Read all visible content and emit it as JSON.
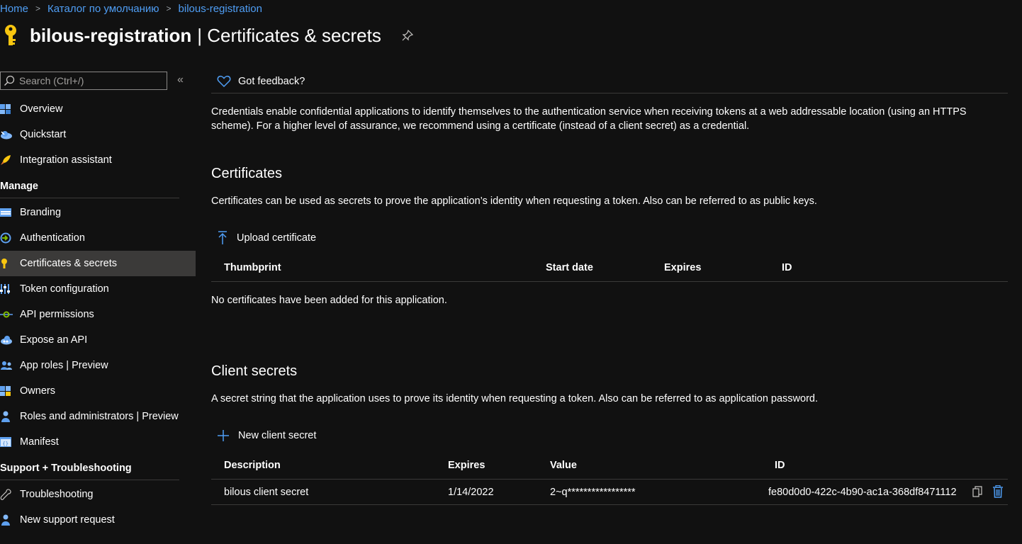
{
  "breadcrumb": [
    "Home",
    "Каталог по умолчанию",
    "bilous-registration"
  ],
  "header": {
    "app_name": "bilous-registration",
    "page_name": "| Certificates & secrets"
  },
  "sidebar": {
    "search_placeholder": "Search (Ctrl+/)",
    "collapse": "«",
    "top_items": [
      {
        "label": "Overview",
        "icon": "overview-icon"
      },
      {
        "label": "Quickstart",
        "icon": "quickstart-icon"
      },
      {
        "label": "Integration assistant",
        "icon": "rocket-icon"
      }
    ],
    "manage_title": "Manage",
    "manage_items": [
      {
        "label": "Branding",
        "icon": "branding-icon"
      },
      {
        "label": "Authentication",
        "icon": "authentication-icon"
      },
      {
        "label": "Certificates & secrets",
        "icon": "key-icon",
        "active": true
      },
      {
        "label": "Token configuration",
        "icon": "token-icon"
      },
      {
        "label": "API permissions",
        "icon": "api-permissions-icon"
      },
      {
        "label": "Expose an API",
        "icon": "cloud-icon"
      },
      {
        "label": "App roles | Preview",
        "icon": "app-roles-icon"
      },
      {
        "label": "Owners",
        "icon": "owners-icon"
      },
      {
        "label": "Roles and administrators | Preview",
        "icon": "roles-admin-icon"
      },
      {
        "label": "Manifest",
        "icon": "manifest-icon"
      }
    ],
    "support_title": "Support + Troubleshooting",
    "support_items": [
      {
        "label": "Troubleshooting",
        "icon": "wrench-icon"
      },
      {
        "label": "New support request",
        "icon": "support-person-icon"
      }
    ]
  },
  "main": {
    "feedback": "Got feedback?",
    "intro": "Credentials enable confidential applications to identify themselves to the authentication service when receiving tokens at a web addressable location (using an HTTPS scheme). For a higher level of assurance, we recommend using a certificate (instead of a client secret) as a credential.",
    "certificates": {
      "title": "Certificates",
      "description": "Certificates can be used as secrets to prove the application’s identity when requesting a token. Also can be referred to as public keys.",
      "upload_label": "Upload certificate",
      "columns": [
        "Thumbprint",
        "Start date",
        "Expires",
        "ID"
      ],
      "empty": "No certificates have been added for this application."
    },
    "client_secrets": {
      "title": "Client secrets",
      "description": "A secret string that the application uses to prove its identity when requesting a token. Also can be referred to as application password.",
      "new_label": "New client secret",
      "columns": [
        "Description",
        "Expires",
        "Value",
        "ID"
      ],
      "rows": [
        {
          "description": "bilous client secret",
          "expires": "1/14/2022",
          "value": "2~q*****************",
          "id": "fe80d0d0-422c-4b90-ac1a-368df8471112"
        }
      ]
    }
  },
  "colors": {
    "link": "#4f9ef5",
    "accent_blue": "#3a96dd",
    "key_yellow": "#f8c60f",
    "bg": "#111111"
  }
}
